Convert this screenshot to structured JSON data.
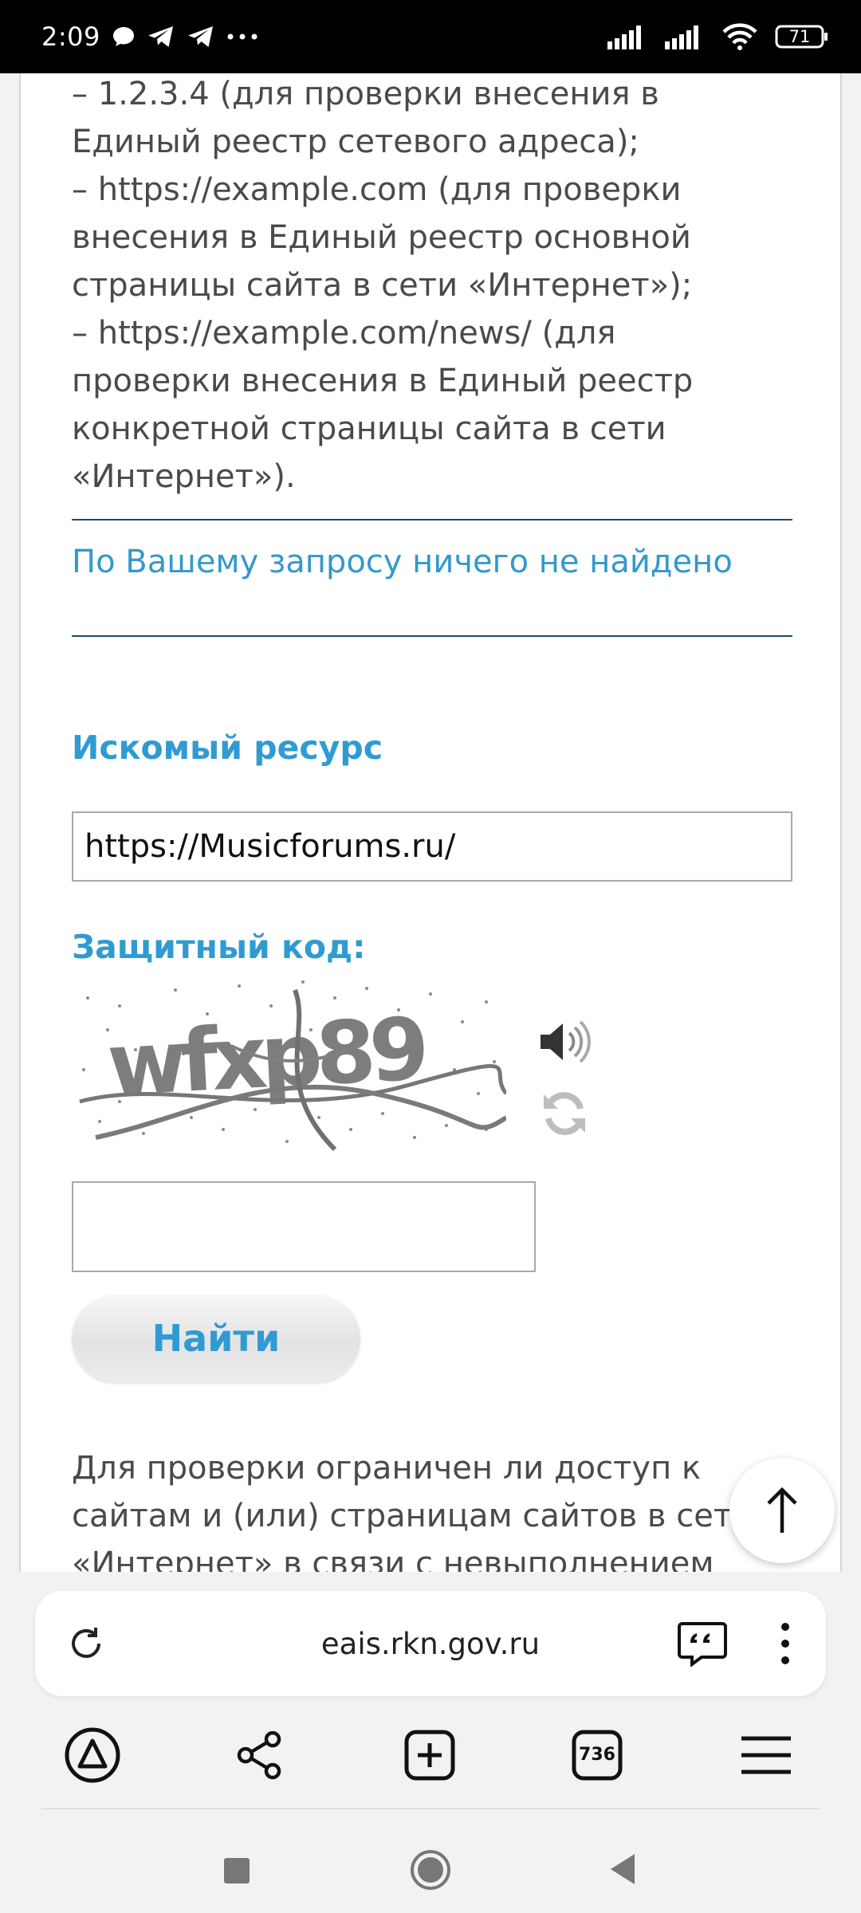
{
  "status_bar": {
    "time": "2:09",
    "battery": "71"
  },
  "page": {
    "info_lines": "– 1.2.3.4 (для проверки внесения в\nЕдиный реестр сетевого адреса);\n– https://example.com (для проверки\nвнесения в Единый реестр основной\nстраницы сайта в сети «Интернет»);\n– https://example.com/news/ (для\nпроверки внесения в Единый реестр\nконкретной страницы сайта в сети\n«Интернет»).",
    "result_message": "По Вашему запросу ничего не найдено",
    "resource_label": "Искомый ресурс",
    "resource_value": "https://Musicforums.ru/",
    "security_code_label": "Защитный код:",
    "captcha_text": "wfxp89",
    "search_button": "Найти",
    "bottom_text": "Для проверки ограничен ли доступ к\nсайтам и (или) страницам сайтов в сети\n«Интернет» в связи с невыполнением"
  },
  "browser": {
    "url": "eais.rkn.gov.ru",
    "tabs_count": "736"
  },
  "colors": {
    "accent": "#2f9bd2",
    "rule": "#1f4a66",
    "text": "#4a4a4a"
  }
}
